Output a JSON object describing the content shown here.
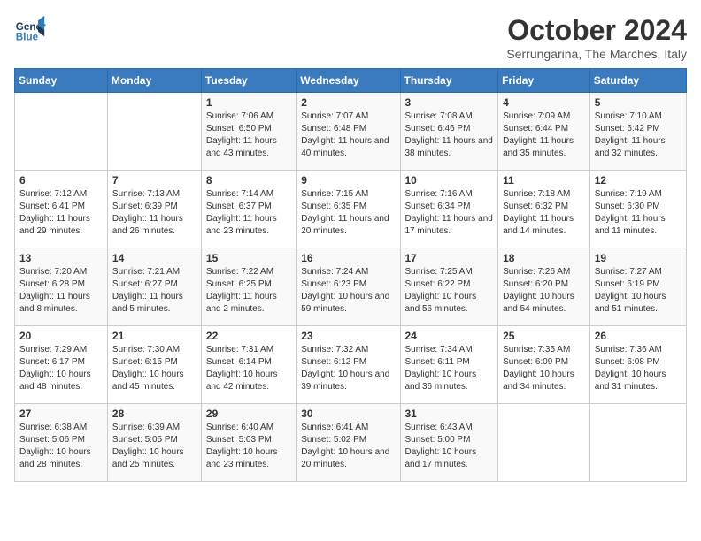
{
  "header": {
    "logo_text_general": "General",
    "logo_text_blue": "Blue",
    "month_title": "October 2024",
    "subtitle": "Serrungarina, The Marches, Italy"
  },
  "days_of_week": [
    "Sunday",
    "Monday",
    "Tuesday",
    "Wednesday",
    "Thursday",
    "Friday",
    "Saturday"
  ],
  "weeks": [
    [
      {
        "day": "",
        "info": ""
      },
      {
        "day": "",
        "info": ""
      },
      {
        "day": "1",
        "info": "Sunrise: 7:06 AM\nSunset: 6:50 PM\nDaylight: 11 hours and 43 minutes."
      },
      {
        "day": "2",
        "info": "Sunrise: 7:07 AM\nSunset: 6:48 PM\nDaylight: 11 hours and 40 minutes."
      },
      {
        "day": "3",
        "info": "Sunrise: 7:08 AM\nSunset: 6:46 PM\nDaylight: 11 hours and 38 minutes."
      },
      {
        "day": "4",
        "info": "Sunrise: 7:09 AM\nSunset: 6:44 PM\nDaylight: 11 hours and 35 minutes."
      },
      {
        "day": "5",
        "info": "Sunrise: 7:10 AM\nSunset: 6:42 PM\nDaylight: 11 hours and 32 minutes."
      }
    ],
    [
      {
        "day": "6",
        "info": "Sunrise: 7:12 AM\nSunset: 6:41 PM\nDaylight: 11 hours and 29 minutes."
      },
      {
        "day": "7",
        "info": "Sunrise: 7:13 AM\nSunset: 6:39 PM\nDaylight: 11 hours and 26 minutes."
      },
      {
        "day": "8",
        "info": "Sunrise: 7:14 AM\nSunset: 6:37 PM\nDaylight: 11 hours and 23 minutes."
      },
      {
        "day": "9",
        "info": "Sunrise: 7:15 AM\nSunset: 6:35 PM\nDaylight: 11 hours and 20 minutes."
      },
      {
        "day": "10",
        "info": "Sunrise: 7:16 AM\nSunset: 6:34 PM\nDaylight: 11 hours and 17 minutes."
      },
      {
        "day": "11",
        "info": "Sunrise: 7:18 AM\nSunset: 6:32 PM\nDaylight: 11 hours and 14 minutes."
      },
      {
        "day": "12",
        "info": "Sunrise: 7:19 AM\nSunset: 6:30 PM\nDaylight: 11 hours and 11 minutes."
      }
    ],
    [
      {
        "day": "13",
        "info": "Sunrise: 7:20 AM\nSunset: 6:28 PM\nDaylight: 11 hours and 8 minutes."
      },
      {
        "day": "14",
        "info": "Sunrise: 7:21 AM\nSunset: 6:27 PM\nDaylight: 11 hours and 5 minutes."
      },
      {
        "day": "15",
        "info": "Sunrise: 7:22 AM\nSunset: 6:25 PM\nDaylight: 11 hours and 2 minutes."
      },
      {
        "day": "16",
        "info": "Sunrise: 7:24 AM\nSunset: 6:23 PM\nDaylight: 10 hours and 59 minutes."
      },
      {
        "day": "17",
        "info": "Sunrise: 7:25 AM\nSunset: 6:22 PM\nDaylight: 10 hours and 56 minutes."
      },
      {
        "day": "18",
        "info": "Sunrise: 7:26 AM\nSunset: 6:20 PM\nDaylight: 10 hours and 54 minutes."
      },
      {
        "day": "19",
        "info": "Sunrise: 7:27 AM\nSunset: 6:19 PM\nDaylight: 10 hours and 51 minutes."
      }
    ],
    [
      {
        "day": "20",
        "info": "Sunrise: 7:29 AM\nSunset: 6:17 PM\nDaylight: 10 hours and 48 minutes."
      },
      {
        "day": "21",
        "info": "Sunrise: 7:30 AM\nSunset: 6:15 PM\nDaylight: 10 hours and 45 minutes."
      },
      {
        "day": "22",
        "info": "Sunrise: 7:31 AM\nSunset: 6:14 PM\nDaylight: 10 hours and 42 minutes."
      },
      {
        "day": "23",
        "info": "Sunrise: 7:32 AM\nSunset: 6:12 PM\nDaylight: 10 hours and 39 minutes."
      },
      {
        "day": "24",
        "info": "Sunrise: 7:34 AM\nSunset: 6:11 PM\nDaylight: 10 hours and 36 minutes."
      },
      {
        "day": "25",
        "info": "Sunrise: 7:35 AM\nSunset: 6:09 PM\nDaylight: 10 hours and 34 minutes."
      },
      {
        "day": "26",
        "info": "Sunrise: 7:36 AM\nSunset: 6:08 PM\nDaylight: 10 hours and 31 minutes."
      }
    ],
    [
      {
        "day": "27",
        "info": "Sunrise: 6:38 AM\nSunset: 5:06 PM\nDaylight: 10 hours and 28 minutes."
      },
      {
        "day": "28",
        "info": "Sunrise: 6:39 AM\nSunset: 5:05 PM\nDaylight: 10 hours and 25 minutes."
      },
      {
        "day": "29",
        "info": "Sunrise: 6:40 AM\nSunset: 5:03 PM\nDaylight: 10 hours and 23 minutes."
      },
      {
        "day": "30",
        "info": "Sunrise: 6:41 AM\nSunset: 5:02 PM\nDaylight: 10 hours and 20 minutes."
      },
      {
        "day": "31",
        "info": "Sunrise: 6:43 AM\nSunset: 5:00 PM\nDaylight: 10 hours and 17 minutes."
      },
      {
        "day": "",
        "info": ""
      },
      {
        "day": "",
        "info": ""
      }
    ]
  ]
}
